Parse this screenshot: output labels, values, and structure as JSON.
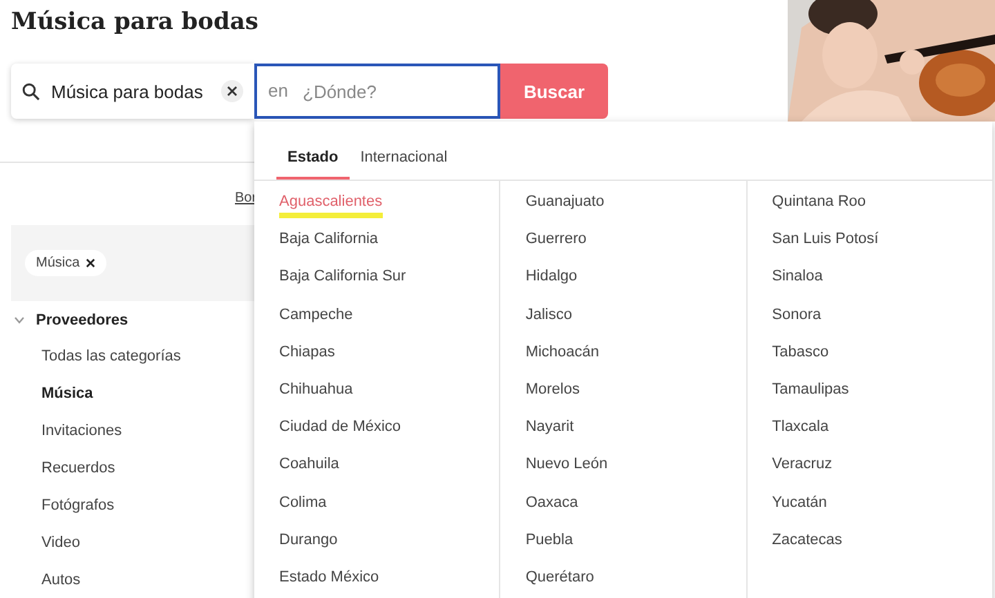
{
  "page_title": "Música para bodas",
  "search": {
    "value": "Música para bodas",
    "where_prefix": "en",
    "where_placeholder": "¿Dónde?",
    "button": "Buscar"
  },
  "clear_link": "Bor",
  "filter_chips": [
    {
      "label": "Música"
    }
  ],
  "sidebar": {
    "heading": "Proveedores",
    "expanded": true,
    "items": [
      {
        "label": "Todas las categorías",
        "selected": false
      },
      {
        "label": "Música",
        "selected": true
      },
      {
        "label": "Invitaciones",
        "selected": false
      },
      {
        "label": "Recuerdos",
        "selected": false
      },
      {
        "label": "Fotógrafos",
        "selected": false
      },
      {
        "label": "Video",
        "selected": false
      },
      {
        "label": "Autos",
        "selected": false
      }
    ]
  },
  "dropdown": {
    "tabs": [
      {
        "label": "Estado",
        "selected": true
      },
      {
        "label": "Internacional",
        "selected": false
      }
    ],
    "columns": [
      [
        {
          "label": "Aguascalientes",
          "selected": true
        },
        {
          "label": "Baja California",
          "selected": false
        },
        {
          "label": "Baja California Sur",
          "selected": false
        },
        {
          "label": "Campeche",
          "selected": false
        },
        {
          "label": "Chiapas",
          "selected": false
        },
        {
          "label": "Chihuahua",
          "selected": false
        },
        {
          "label": "Ciudad de México",
          "selected": false
        },
        {
          "label": "Coahuila",
          "selected": false
        },
        {
          "label": "Colima",
          "selected": false
        },
        {
          "label": "Durango",
          "selected": false
        },
        {
          "label": "Estado México",
          "selected": false
        }
      ],
      [
        {
          "label": "Guanajuato",
          "selected": false
        },
        {
          "label": "Guerrero",
          "selected": false
        },
        {
          "label": "Hidalgo",
          "selected": false
        },
        {
          "label": "Jalisco",
          "selected": false
        },
        {
          "label": "Michoacán",
          "selected": false
        },
        {
          "label": "Morelos",
          "selected": false
        },
        {
          "label": "Nayarit",
          "selected": false
        },
        {
          "label": "Nuevo León",
          "selected": false
        },
        {
          "label": "Oaxaca",
          "selected": false
        },
        {
          "label": "Puebla",
          "selected": false
        },
        {
          "label": "Querétaro",
          "selected": false
        }
      ],
      [
        {
          "label": "Quintana Roo",
          "selected": false
        },
        {
          "label": "San Luis Potosí",
          "selected": false
        },
        {
          "label": "Sinaloa",
          "selected": false
        },
        {
          "label": "Sonora",
          "selected": false
        },
        {
          "label": "Tabasco",
          "selected": false
        },
        {
          "label": "Tamaulipas",
          "selected": false
        },
        {
          "label": "Tlaxcala",
          "selected": false
        },
        {
          "label": "Veracruz",
          "selected": false
        },
        {
          "label": "Yucatán",
          "selected": false
        },
        {
          "label": "Zacatecas",
          "selected": false
        }
      ]
    ]
  }
}
